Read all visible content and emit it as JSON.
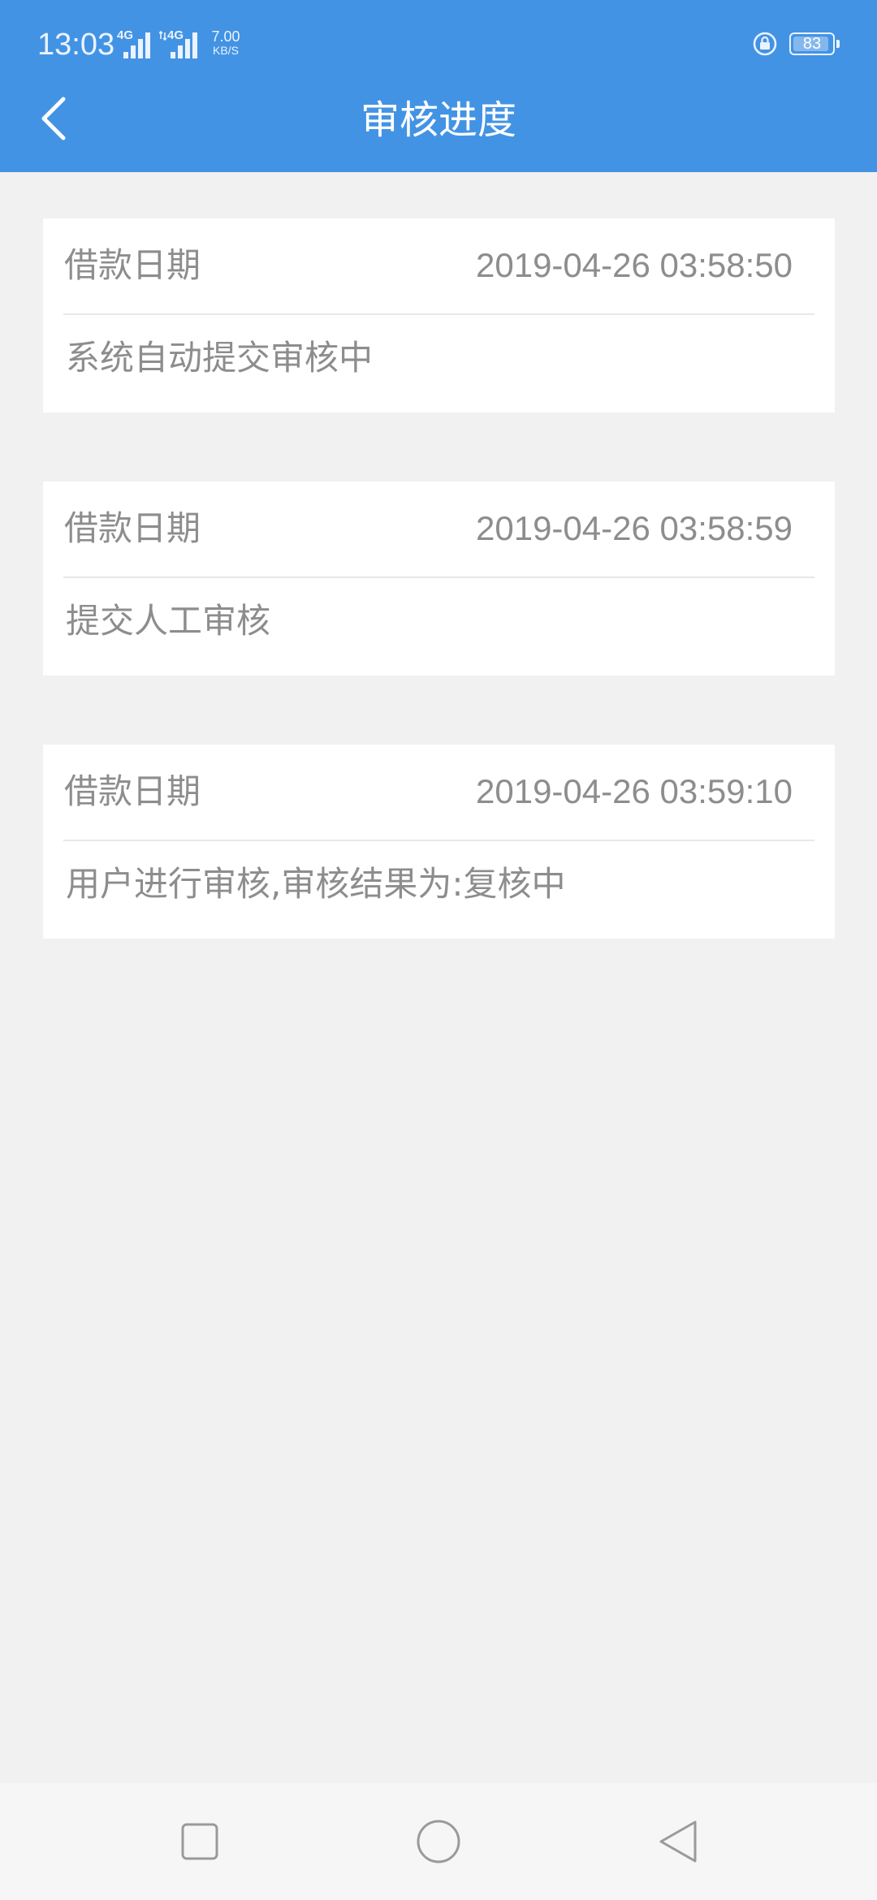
{
  "status_bar": {
    "time": "13:03",
    "signal1_tag": "4G",
    "signal2_tag": "4G",
    "net_speed_value": "7.00",
    "net_speed_unit": "KB/S",
    "battery_level": "83",
    "icons": [
      "signal-icon",
      "signal-icon",
      "lock-rotation-icon",
      "battery-icon"
    ]
  },
  "header": {
    "title": "审核进度",
    "back_icon": "back-chevron-icon",
    "background_color": "#4393e4"
  },
  "records": [
    {
      "label": "借款日期",
      "datetime": "2019-04-26 03:58:50",
      "description": "系统自动提交审核中"
    },
    {
      "label": "借款日期",
      "datetime": "2019-04-26 03:58:59",
      "description": "提交人工审核"
    },
    {
      "label": "借款日期",
      "datetime": "2019-04-26 03:59:10",
      "description": "用户进行审核,审核结果为:复核中"
    }
  ],
  "nav_bar": {
    "icons": [
      "recents-square-icon",
      "home-circle-icon",
      "back-triangle-icon"
    ]
  },
  "colors": {
    "page_background": "#f1f1f1",
    "card_background": "#ffffff",
    "text_gray": "#8d8d8d",
    "divider": "#e8e8e8"
  }
}
